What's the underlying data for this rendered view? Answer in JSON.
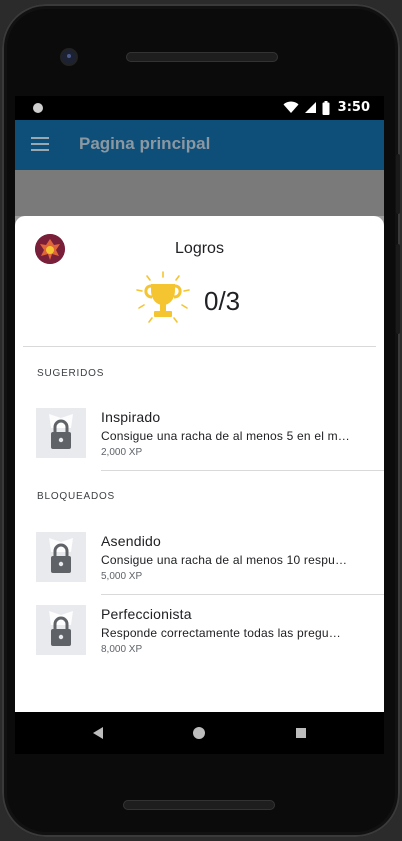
{
  "status_bar": {
    "time": "3:50"
  },
  "app_bar": {
    "title": "Pagina principal"
  },
  "sheet": {
    "title": "Logros",
    "score": "0/3"
  },
  "sections": {
    "suggested": "SUGERIDOS",
    "locked": "BLOQUEADOS"
  },
  "achievements": [
    {
      "name": "Inspirado",
      "description": "Consigue una racha de al menos 5 en el m…",
      "xp": "2,000 XP"
    },
    {
      "name": "Asendido",
      "description": "Consigue una racha de al menos 10 respu…",
      "xp": "5,000 XP"
    },
    {
      "name": "Perfeccionista",
      "description": "Responde correctamente todas las pregu…",
      "xp": "8,000 XP"
    }
  ],
  "colors": {
    "app_bar": "#0e4f7a",
    "trophy": "#f5c431",
    "lock": "#5f6368"
  },
  "icons": [
    "menu-icon",
    "trophy-icon",
    "lock-icon",
    "wifi-icon",
    "signal-icon",
    "battery-icon",
    "back-icon",
    "home-icon",
    "recents-icon"
  ]
}
